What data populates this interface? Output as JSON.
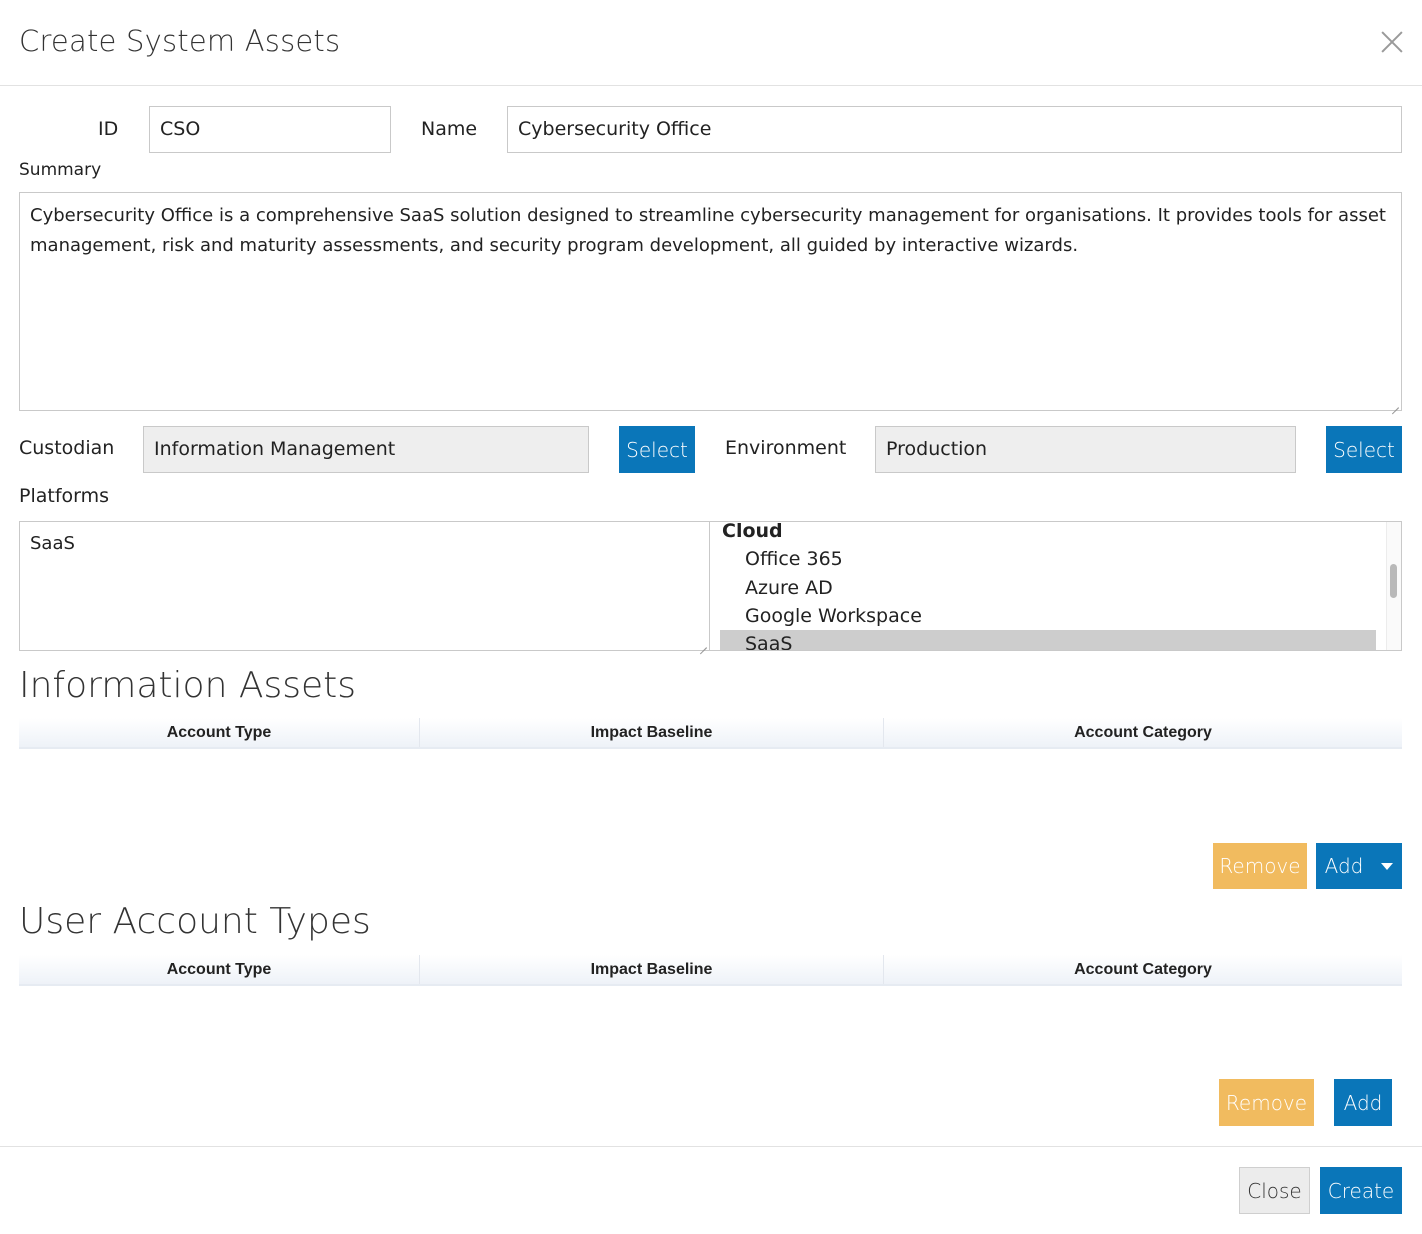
{
  "dialog": {
    "title": "Create System Assets"
  },
  "form": {
    "id_label": "ID",
    "id_value": "CSO",
    "name_label": "Name",
    "name_value": "Cybersecurity Office",
    "summary_label": "Summary",
    "summary_value": "Cybersecurity Office is a comprehensive SaaS solution designed to streamline cybersecurity management for organisations. It provides tools for asset management, risk and maturity assessments, and security program development, all guided by interactive wizards.",
    "custodian_label": "Custodian",
    "custodian_value": "Information Management",
    "custodian_select": "Select",
    "environment_label": "Environment",
    "environment_value": "Production",
    "environment_select": "Select",
    "platforms_label": "Platforms",
    "platforms_selected": "SaaS",
    "platform_group": "Cloud",
    "platform_options": [
      "Office 365",
      "Azure AD",
      "Google Workspace",
      "SaaS"
    ],
    "platform_selected_option": "SaaS"
  },
  "information_assets": {
    "title": "Information Assets",
    "columns": [
      "Account Type",
      "Impact Baseline",
      "Account Category"
    ],
    "rows": [],
    "remove_label": "Remove",
    "add_label": "Add"
  },
  "user_account_types": {
    "title": "User Account Types",
    "columns": [
      "Account Type",
      "Impact Baseline",
      "Account Category"
    ],
    "rows": [],
    "remove_label": "Remove",
    "add_label": "Add"
  },
  "footer": {
    "close_label": "Close",
    "create_label": "Create"
  },
  "colors": {
    "primary": "#0a76b9",
    "warning": "#f1bb5f",
    "readonly_bg": "#eeeeee",
    "selected_option_bg": "#cdcdcd"
  },
  "icons": {
    "close": "close-icon",
    "dropdown": "caret-down-icon"
  }
}
